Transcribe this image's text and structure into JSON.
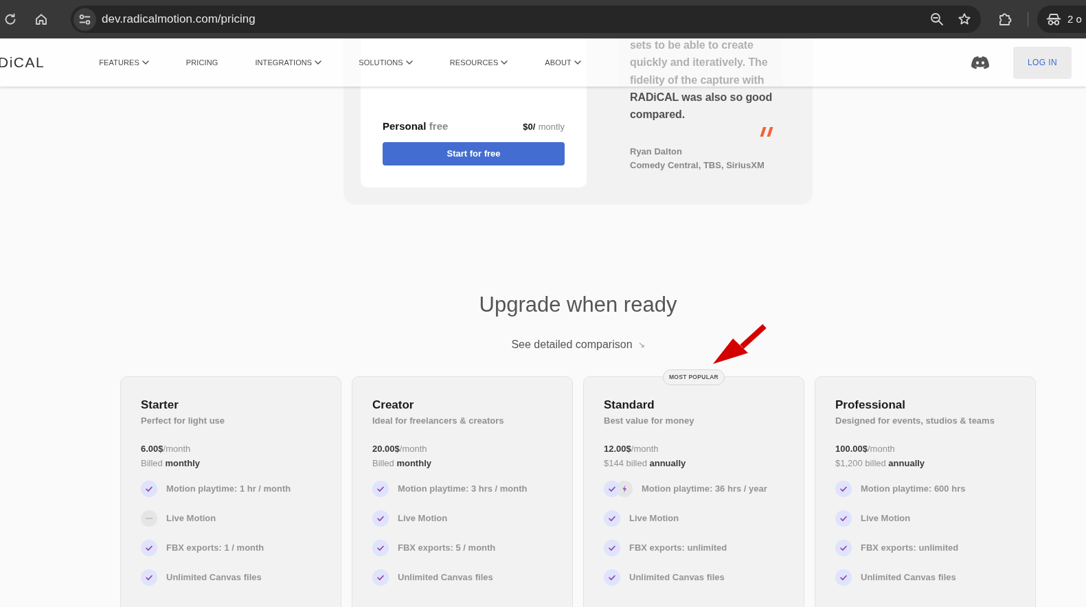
{
  "browser": {
    "url": "dev.radicalmotion.com/pricing",
    "profile_label": "2 о"
  },
  "nav": {
    "logo": "DiCAL",
    "items": [
      {
        "label": "FEATURES",
        "dropdown": true
      },
      {
        "label": "PRICING",
        "dropdown": false
      },
      {
        "label": "INTEGRATIONS",
        "dropdown": true
      },
      {
        "label": "SOLUTIONS",
        "dropdown": true
      },
      {
        "label": "RESOURCES",
        "dropdown": true
      },
      {
        "label": "ABOUT",
        "dropdown": true
      }
    ],
    "login": "LOG IN"
  },
  "personal_plan": {
    "name": "Personal",
    "tag": "free",
    "price": "$0/",
    "period": "montly",
    "button": "Start for free"
  },
  "testimonial": {
    "lines": [
      "sets to be able to create",
      "quickly and iteratively. The",
      "fidelity of the capture with",
      "RADiCAL was also so good",
      "compared."
    ],
    "author": "Ryan Dalton",
    "company": "Comedy Central, TBS, SiriusXM"
  },
  "upgrade": {
    "heading": "Upgrade when ready",
    "comparison_link": "See detailed comparison",
    "link_arrow": "↘"
  },
  "plans": [
    {
      "name": "Starter",
      "subtitle": "Perfect for light use",
      "price": "**6.00$**/month",
      "billing": "Billed **monthly**",
      "features": [
        {
          "kind": "check",
          "text": "Motion playtime: 1 hr / month"
        },
        {
          "kind": "none",
          "text": "Live Motion"
        },
        {
          "kind": "check",
          "text": "FBX exports: 1 / month"
        },
        {
          "kind": "check",
          "text": "Unlimited Canvas files"
        }
      ]
    },
    {
      "name": "Creator",
      "subtitle": "Ideal for freelancers & creators",
      "price": "**20.00$**/month",
      "billing": "Billed **monthly**",
      "features": [
        {
          "kind": "check",
          "text": "Motion playtime: 3 hrs / month"
        },
        {
          "kind": "check",
          "text": "Live Motion"
        },
        {
          "kind": "check",
          "text": "FBX exports: 5 / month"
        },
        {
          "kind": "check",
          "text": "Unlimited Canvas files"
        }
      ]
    },
    {
      "name": "Standard",
      "badge": "MOST POPULAR",
      "subtitle": "Best value for money",
      "price": "**12.00$**/month",
      "billing": "$144 billed **annually**",
      "features": [
        {
          "kind": "check_bolt",
          "text": "Motion playtime: 36 hrs / year"
        },
        {
          "kind": "check",
          "text": "Live Motion"
        },
        {
          "kind": "check",
          "text": "FBX exports: unlimited"
        },
        {
          "kind": "check",
          "text": "Unlimited Canvas files"
        }
      ]
    },
    {
      "name": "Professional",
      "subtitle": "Designed for events, studios & teams",
      "price": "**100.00$**/month",
      "billing": "$1,200 billed **annually**",
      "features": [
        {
          "kind": "check",
          "text": "Motion playtime: 600 hrs"
        },
        {
          "kind": "check",
          "text": "Live Motion"
        },
        {
          "kind": "check",
          "text": "FBX exports: unlimited"
        },
        {
          "kind": "check",
          "text": "Unlimited Canvas files"
        }
      ]
    }
  ],
  "annotation_arrow": true
}
